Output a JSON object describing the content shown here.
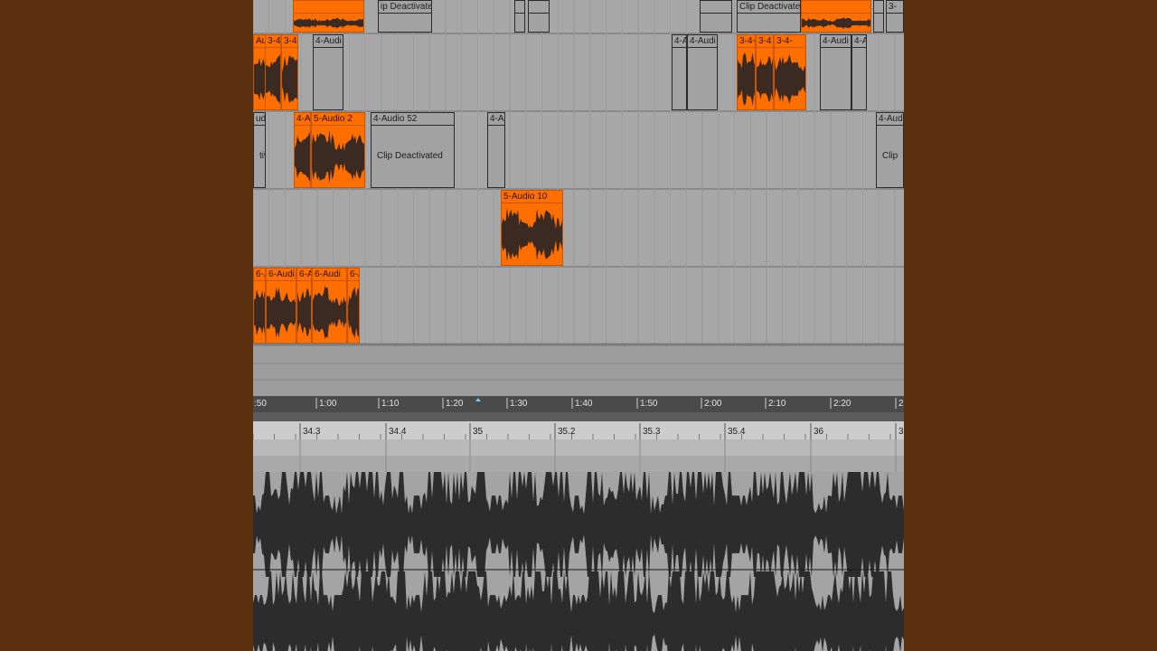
{
  "arrangement": {
    "tracks": [
      {
        "id": "t1",
        "clips": [
          {
            "kind": "active",
            "label": ""
          },
          {
            "kind": "deact",
            "label": "ip Deactivated"
          },
          {
            "kind": "deact",
            "label": ""
          },
          {
            "kind": "deact",
            "label": ""
          },
          {
            "kind": "deact",
            "label": ""
          },
          {
            "kind": "deact",
            "label": "Clip Deactivated"
          },
          {
            "kind": "active",
            "label": ""
          },
          {
            "kind": "deact",
            "label": ""
          },
          {
            "kind": "deact",
            "label": "3-"
          }
        ]
      },
      {
        "id": "t2",
        "clips": [
          {
            "kind": "active",
            "label": "Aud"
          },
          {
            "kind": "active",
            "label": "3-4"
          },
          {
            "kind": "active",
            "label": "3-4-"
          },
          {
            "kind": "deact",
            "label": "4-Audi"
          },
          {
            "kind": "deact",
            "label": "4-A"
          },
          {
            "kind": "deact",
            "label": "4-Audi"
          },
          {
            "kind": "active",
            "label": "3-4-Aud"
          },
          {
            "kind": "active",
            "label": "3-4"
          },
          {
            "kind": "active",
            "label": "3-4-"
          },
          {
            "kind": "deact",
            "label": "4-Audi"
          },
          {
            "kind": "deact",
            "label": "4-A"
          }
        ]
      },
      {
        "id": "t3",
        "clips": [
          {
            "kind": "deact",
            "label": "udio",
            "mid": "tiva"
          },
          {
            "kind": "active",
            "label": "4-A"
          },
          {
            "kind": "active",
            "label": "5-Audio 2"
          },
          {
            "kind": "deact",
            "label": "4-Audio 52",
            "mid": "Clip Deactivated"
          },
          {
            "kind": "deact",
            "label": "4-Au"
          },
          {
            "kind": "deact",
            "label": "4-Aud",
            "mid": "Clip"
          }
        ]
      },
      {
        "id": "t4",
        "clips": [
          {
            "kind": "active",
            "label": "5-Audio 10"
          }
        ]
      },
      {
        "id": "t5",
        "clips": [
          {
            "kind": "active",
            "label": "6-A"
          },
          {
            "kind": "active",
            "label": "6-Audi"
          },
          {
            "kind": "active",
            "label": "6-A"
          },
          {
            "kind": "active",
            "label": "6-Audi"
          },
          {
            "kind": "active",
            "label": "6-A"
          }
        ]
      }
    ]
  },
  "time_ruler": {
    "labels": [
      ":50",
      "1:00",
      "1:10",
      "1:20",
      "1:30",
      "1:40",
      "1:50",
      "2:00",
      "2:10",
      "2:20",
      "2"
    ]
  },
  "detail_ruler": {
    "labels": [
      "34.3",
      "34.4",
      "35",
      "35.2",
      "35.3",
      "35.4",
      "36",
      "3"
    ]
  },
  "colors": {
    "background": "#5a2f10",
    "clip_active": "#ff6f00",
    "clip_deactivated": "#a2a2a2",
    "waveform": "#3a2a22",
    "detail_waveform": "#2c2c2c",
    "loop_marker": "#66ccff"
  }
}
